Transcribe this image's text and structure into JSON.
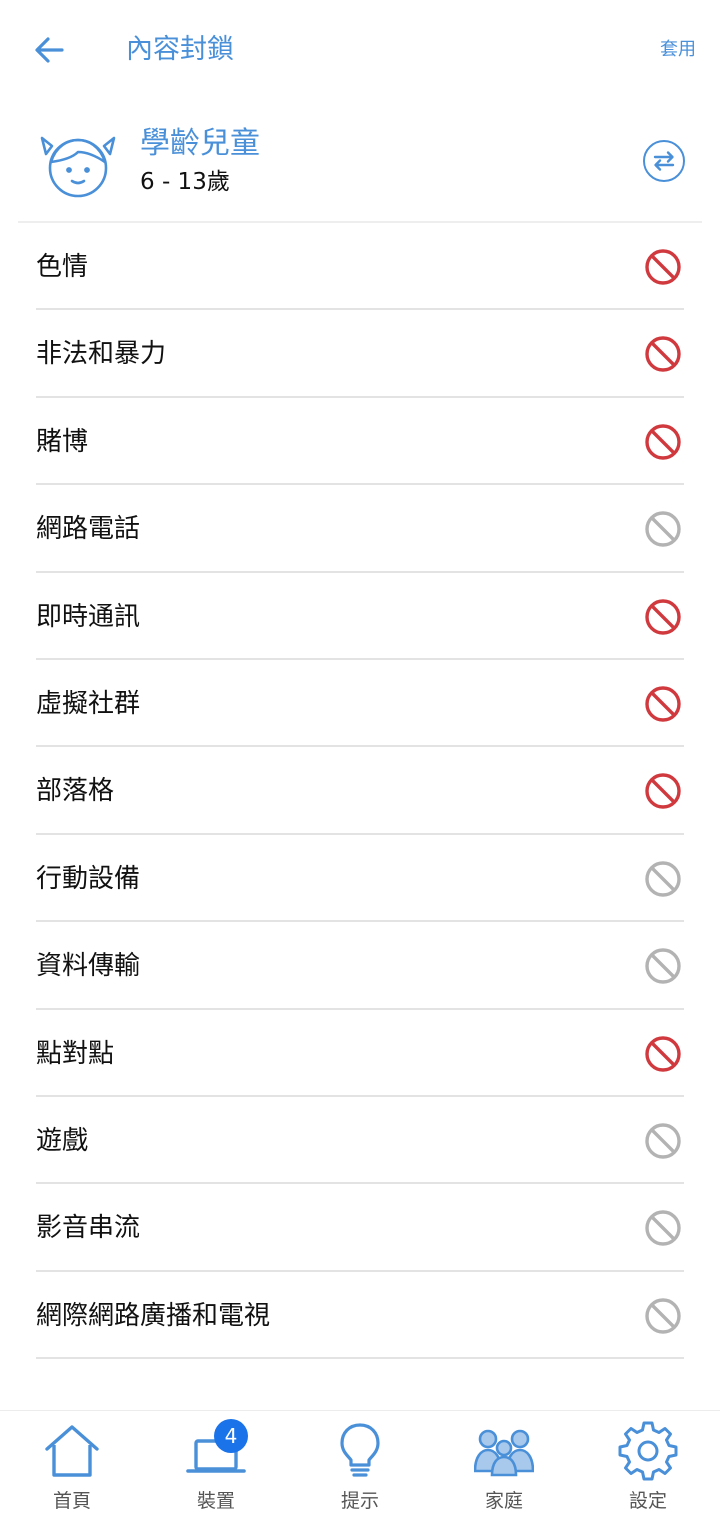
{
  "header": {
    "title": "內容封鎖",
    "apply_label": "套用",
    "back_icon": "arrow-left-icon"
  },
  "profile": {
    "name": "學齡兒童",
    "age": "6 - 13歲",
    "avatar_icon": "child-avatar-icon",
    "switch_icon": "swap-icon"
  },
  "colors": {
    "accent": "#4a90d9",
    "blocked": "#d0393e",
    "allowed": "#b3b3b3",
    "badge": "#1a73e8"
  },
  "categories": [
    {
      "label": "色情",
      "status": "blocked"
    },
    {
      "label": "非法和暴力",
      "status": "blocked"
    },
    {
      "label": "賭博",
      "status": "blocked"
    },
    {
      "label": "網路電話",
      "status": "allowed"
    },
    {
      "label": "即時通訊",
      "status": "blocked"
    },
    {
      "label": "虛擬社群",
      "status": "blocked"
    },
    {
      "label": "部落格",
      "status": "blocked"
    },
    {
      "label": "行動設備",
      "status": "allowed"
    },
    {
      "label": "資料傳輸",
      "status": "allowed"
    },
    {
      "label": "點對點",
      "status": "blocked"
    },
    {
      "label": "遊戲",
      "status": "allowed"
    },
    {
      "label": "影音串流",
      "status": "allowed"
    },
    {
      "label": "網際網路廣播和電視",
      "status": "allowed"
    }
  ],
  "tabbar": {
    "badge_count": "4",
    "tabs": [
      {
        "label": "首頁",
        "icon": "home-icon"
      },
      {
        "label": "裝置",
        "icon": "laptop-icon"
      },
      {
        "label": "提示",
        "icon": "lightbulb-icon"
      },
      {
        "label": "家庭",
        "icon": "family-icon"
      },
      {
        "label": "設定",
        "icon": "gear-icon"
      }
    ]
  }
}
